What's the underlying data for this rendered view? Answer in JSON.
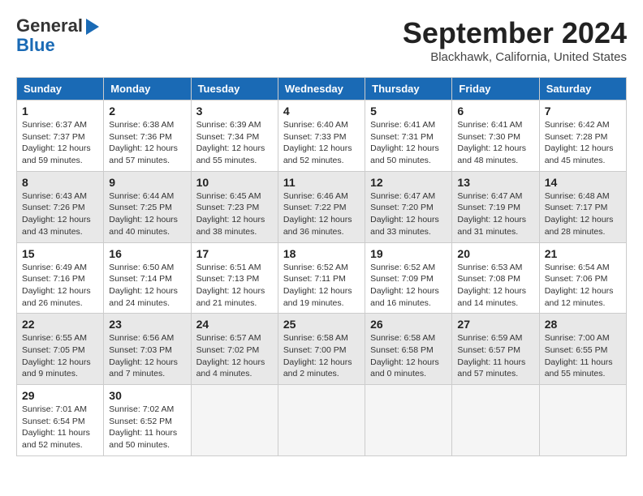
{
  "header": {
    "logo_line1": "General",
    "logo_line2": "Blue",
    "month": "September 2024",
    "location": "Blackhawk, California, United States"
  },
  "weekdays": [
    "Sunday",
    "Monday",
    "Tuesday",
    "Wednesday",
    "Thursday",
    "Friday",
    "Saturday"
  ],
  "weeks": [
    [
      {
        "day": "1",
        "info": "Sunrise: 6:37 AM\nSunset: 7:37 PM\nDaylight: 12 hours\nand 59 minutes."
      },
      {
        "day": "2",
        "info": "Sunrise: 6:38 AM\nSunset: 7:36 PM\nDaylight: 12 hours\nand 57 minutes."
      },
      {
        "day": "3",
        "info": "Sunrise: 6:39 AM\nSunset: 7:34 PM\nDaylight: 12 hours\nand 55 minutes."
      },
      {
        "day": "4",
        "info": "Sunrise: 6:40 AM\nSunset: 7:33 PM\nDaylight: 12 hours\nand 52 minutes."
      },
      {
        "day": "5",
        "info": "Sunrise: 6:41 AM\nSunset: 7:31 PM\nDaylight: 12 hours\nand 50 minutes."
      },
      {
        "day": "6",
        "info": "Sunrise: 6:41 AM\nSunset: 7:30 PM\nDaylight: 12 hours\nand 48 minutes."
      },
      {
        "day": "7",
        "info": "Sunrise: 6:42 AM\nSunset: 7:28 PM\nDaylight: 12 hours\nand 45 minutes."
      }
    ],
    [
      {
        "day": "8",
        "info": "Sunrise: 6:43 AM\nSunset: 7:26 PM\nDaylight: 12 hours\nand 43 minutes."
      },
      {
        "day": "9",
        "info": "Sunrise: 6:44 AM\nSunset: 7:25 PM\nDaylight: 12 hours\nand 40 minutes."
      },
      {
        "day": "10",
        "info": "Sunrise: 6:45 AM\nSunset: 7:23 PM\nDaylight: 12 hours\nand 38 minutes."
      },
      {
        "day": "11",
        "info": "Sunrise: 6:46 AM\nSunset: 7:22 PM\nDaylight: 12 hours\nand 36 minutes."
      },
      {
        "day": "12",
        "info": "Sunrise: 6:47 AM\nSunset: 7:20 PM\nDaylight: 12 hours\nand 33 minutes."
      },
      {
        "day": "13",
        "info": "Sunrise: 6:47 AM\nSunset: 7:19 PM\nDaylight: 12 hours\nand 31 minutes."
      },
      {
        "day": "14",
        "info": "Sunrise: 6:48 AM\nSunset: 7:17 PM\nDaylight: 12 hours\nand 28 minutes."
      }
    ],
    [
      {
        "day": "15",
        "info": "Sunrise: 6:49 AM\nSunset: 7:16 PM\nDaylight: 12 hours\nand 26 minutes."
      },
      {
        "day": "16",
        "info": "Sunrise: 6:50 AM\nSunset: 7:14 PM\nDaylight: 12 hours\nand 24 minutes."
      },
      {
        "day": "17",
        "info": "Sunrise: 6:51 AM\nSunset: 7:13 PM\nDaylight: 12 hours\nand 21 minutes."
      },
      {
        "day": "18",
        "info": "Sunrise: 6:52 AM\nSunset: 7:11 PM\nDaylight: 12 hours\nand 19 minutes."
      },
      {
        "day": "19",
        "info": "Sunrise: 6:52 AM\nSunset: 7:09 PM\nDaylight: 12 hours\nand 16 minutes."
      },
      {
        "day": "20",
        "info": "Sunrise: 6:53 AM\nSunset: 7:08 PM\nDaylight: 12 hours\nand 14 minutes."
      },
      {
        "day": "21",
        "info": "Sunrise: 6:54 AM\nSunset: 7:06 PM\nDaylight: 12 hours\nand 12 minutes."
      }
    ],
    [
      {
        "day": "22",
        "info": "Sunrise: 6:55 AM\nSunset: 7:05 PM\nDaylight: 12 hours\nand 9 minutes."
      },
      {
        "day": "23",
        "info": "Sunrise: 6:56 AM\nSunset: 7:03 PM\nDaylight: 12 hours\nand 7 minutes."
      },
      {
        "day": "24",
        "info": "Sunrise: 6:57 AM\nSunset: 7:02 PM\nDaylight: 12 hours\nand 4 minutes."
      },
      {
        "day": "25",
        "info": "Sunrise: 6:58 AM\nSunset: 7:00 PM\nDaylight: 12 hours\nand 2 minutes."
      },
      {
        "day": "26",
        "info": "Sunrise: 6:58 AM\nSunset: 6:58 PM\nDaylight: 12 hours\nand 0 minutes."
      },
      {
        "day": "27",
        "info": "Sunrise: 6:59 AM\nSunset: 6:57 PM\nDaylight: 11 hours\nand 57 minutes."
      },
      {
        "day": "28",
        "info": "Sunrise: 7:00 AM\nSunset: 6:55 PM\nDaylight: 11 hours\nand 55 minutes."
      }
    ],
    [
      {
        "day": "29",
        "info": "Sunrise: 7:01 AM\nSunset: 6:54 PM\nDaylight: 11 hours\nand 52 minutes."
      },
      {
        "day": "30",
        "info": "Sunrise: 7:02 AM\nSunset: 6:52 PM\nDaylight: 11 hours\nand 50 minutes."
      },
      {
        "day": "",
        "info": ""
      },
      {
        "day": "",
        "info": ""
      },
      {
        "day": "",
        "info": ""
      },
      {
        "day": "",
        "info": ""
      },
      {
        "day": "",
        "info": ""
      }
    ]
  ]
}
